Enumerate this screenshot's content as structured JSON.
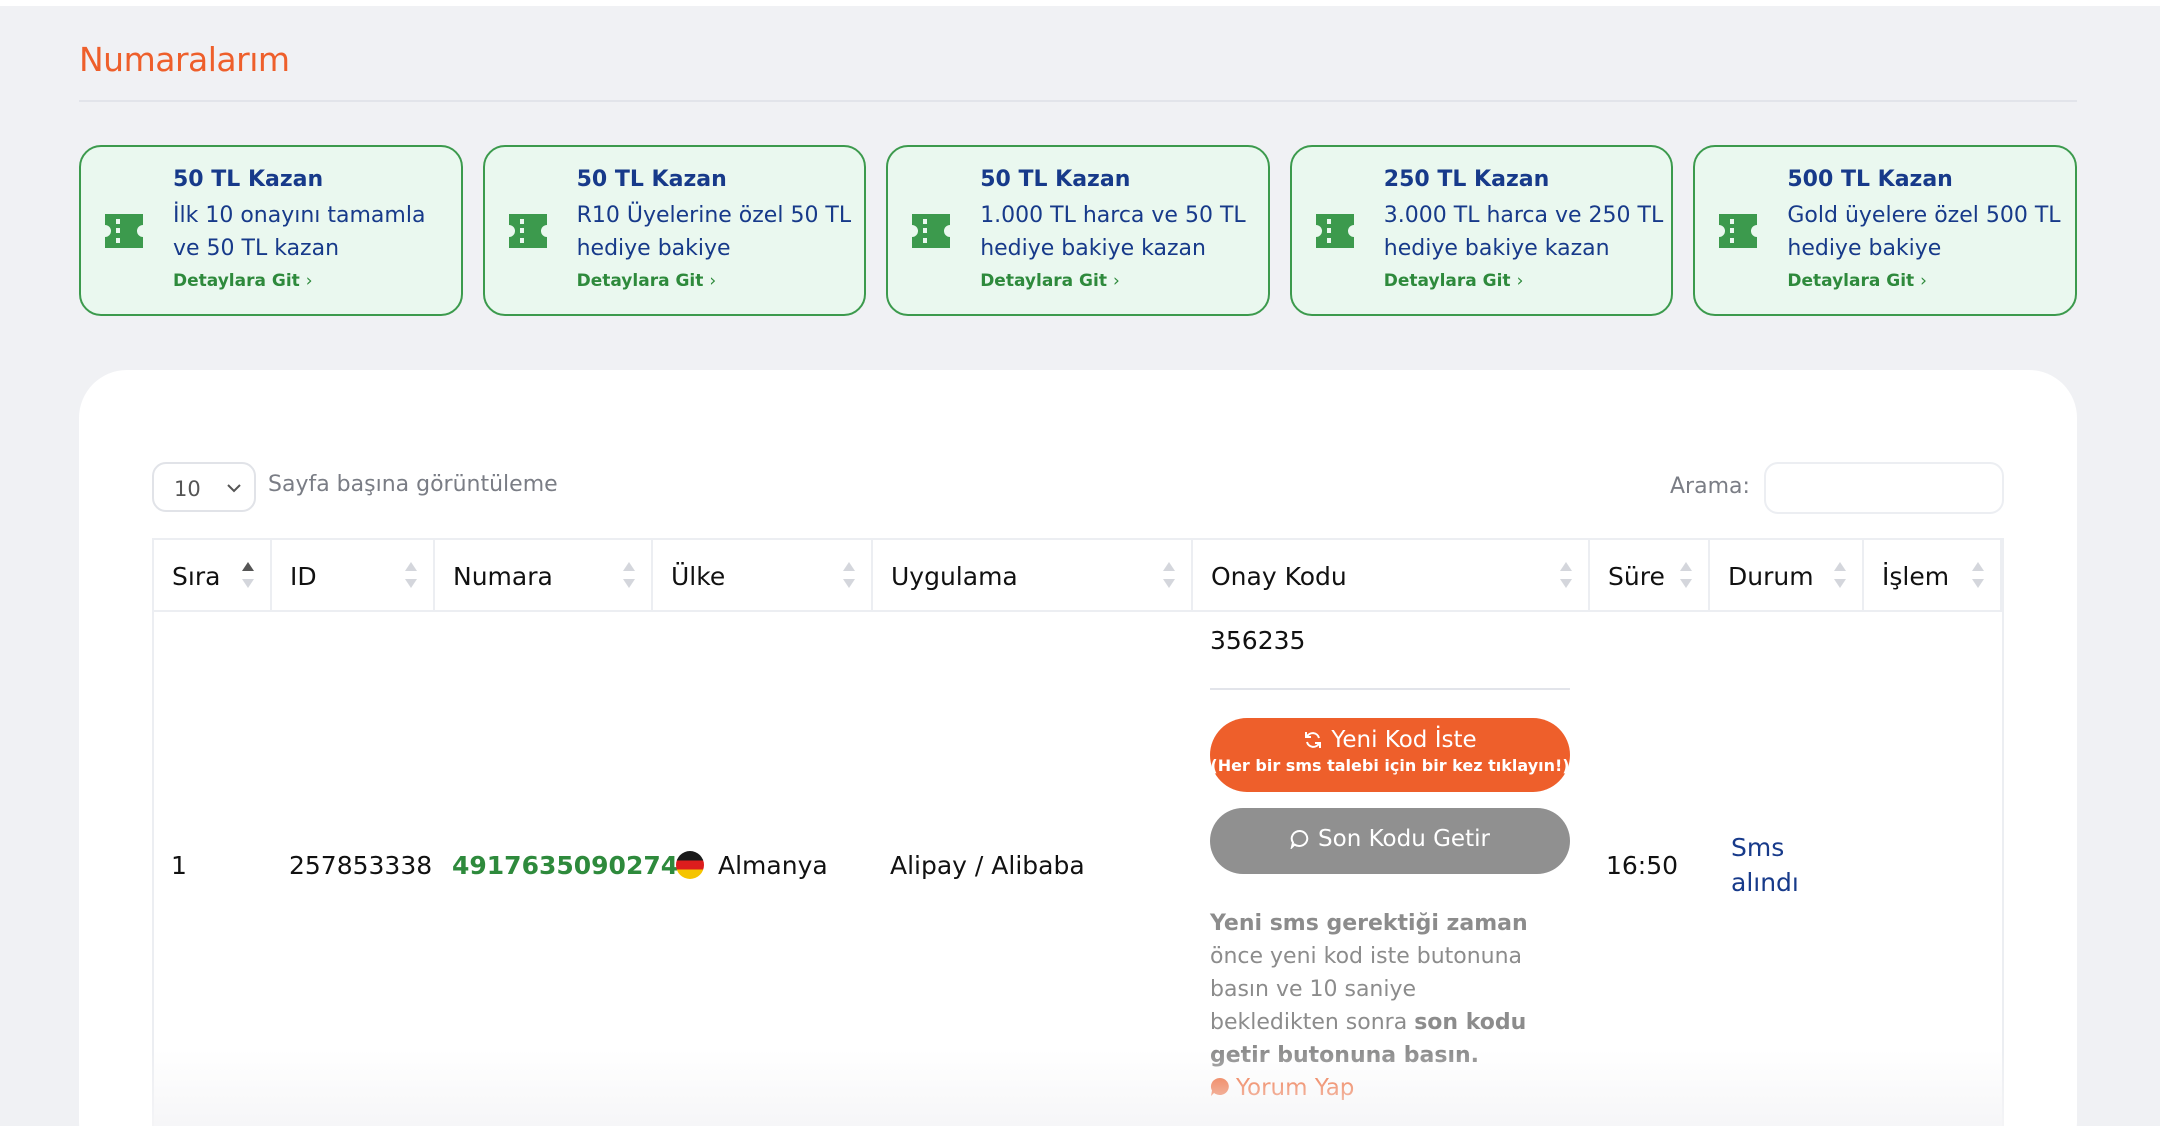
{
  "page": {
    "title": "Numaralarım"
  },
  "promos": [
    {
      "title": "50 TL Kazan",
      "desc": "İlk 10 onayını tamamla ve 50 TL kazan",
      "link": "Detaylara Git"
    },
    {
      "title": "50 TL Kazan",
      "desc": "R10 Üyelerine özel 50 TL hediye bakiye",
      "link": "Detaylara Git"
    },
    {
      "title": "50 TL Kazan",
      "desc": "1.000 TL harca ve 50 TL hediye bakiye kazan",
      "link": "Detaylara Git"
    },
    {
      "title": "250 TL Kazan",
      "desc": "3.000 TL harca ve 250 TL hediye bakiye kazan",
      "link": "Detaylara Git"
    },
    {
      "title": "500 TL Kazan",
      "desc": "Gold üyelere özel 500 TL hediye bakiye",
      "link": "Detaylara Git"
    }
  ],
  "table_controls": {
    "page_length": "10",
    "page_length_label": "Sayfa başına görüntüleme",
    "search_label": "Arama:",
    "search_value": ""
  },
  "columns": [
    "Sıra",
    "ID",
    "Numara",
    "Ülke",
    "Uygulama",
    "Onay Kodu",
    "Süre",
    "Durum",
    "İşlem"
  ],
  "sorted_column": "Sıra",
  "rows": [
    {
      "sira": "1",
      "id": "257853338",
      "numara": "4917635090274",
      "ulke": "Almanya",
      "uygulama": "Alipay / Alibaba",
      "onay_kodu": "356235",
      "sure": "16:50",
      "durum": "Sms alındı",
      "islem": ""
    }
  ],
  "code_actions": {
    "new_code_label": "Yeni Kod İste",
    "new_code_sub": "(Her bir sms talebi için bir kez tıklayın!)",
    "last_code_label": "Son Kodu Getir",
    "hint_bold_1": "Yeni sms gerektiği zaman",
    "hint_mid": " önce yeni kod iste butonuna basın ve 10 saniye bekledikten sonra ",
    "hint_bold_2": "son kodu getir butonuna basın.",
    "comment_label": "Yorum Yap"
  },
  "colors": {
    "accent": "#ee5f2b",
    "promo_bg": "#eaf8ef",
    "promo_border": "#3c9a4d",
    "link_green": "#2e8a3c",
    "navy": "#173a8a",
    "button_gray": "#909090"
  },
  "icons": {
    "promo": "ticket-icon",
    "new_code": "refresh-icon",
    "last_code": "chat-bubble-icon",
    "comment": "comment-icon",
    "flag": "germany-flag-icon"
  }
}
